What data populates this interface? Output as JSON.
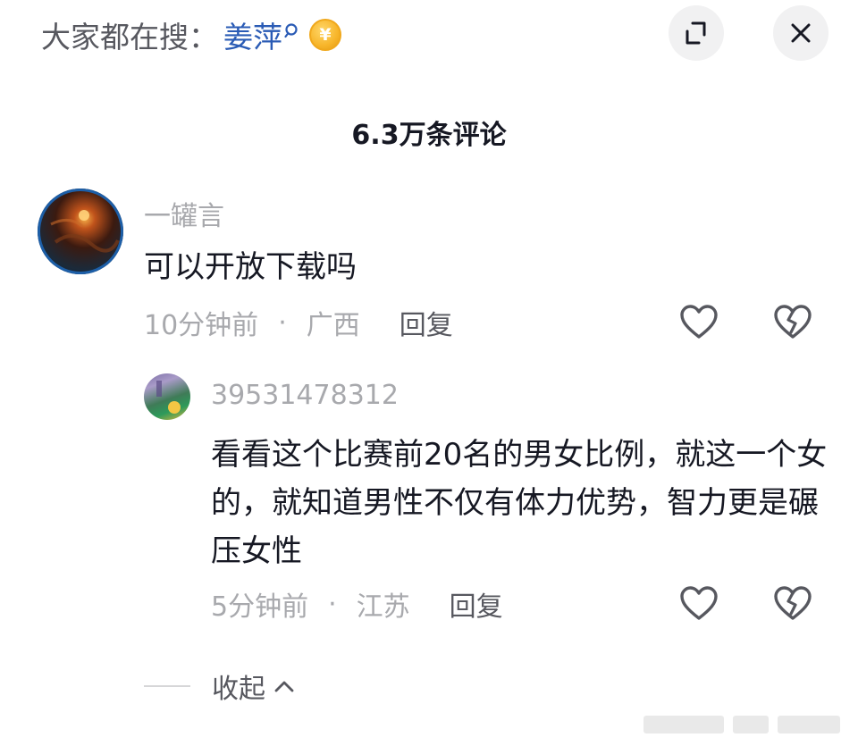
{
  "header": {
    "search_prefix": "大家都在搜：",
    "search_term": "姜萍",
    "coin_symbol": "¥",
    "expand_icon": "expand-icon",
    "close_icon": "close-icon"
  },
  "comment_count": "6.3万条评论",
  "comments": [
    {
      "username": "一罐言",
      "text": "可以开放下载吗",
      "time": "10分钟前",
      "separator": "·",
      "location": "广西",
      "reply_label": "回复"
    },
    {
      "username": "39531478312",
      "text": "看看这个比赛前20名的男女比例，就这一个女的，就知道男性不仅有体力优势，智力更是碾压女性",
      "time": "5分钟前",
      "separator": "·",
      "location": "江苏",
      "reply_label": "回复"
    }
  ],
  "collapse_label": "收起",
  "colors": {
    "accent_link": "#2a5bb5",
    "text_primary": "#161823",
    "text_secondary": "#a8a9ad",
    "coin": "#f7b52a"
  }
}
